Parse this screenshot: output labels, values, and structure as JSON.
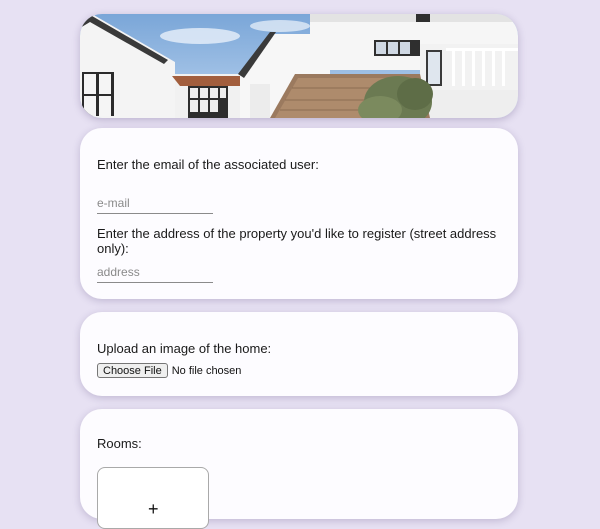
{
  "hero": {
    "alt": "white two-story house with cedar shingle roof and balcony",
    "icon": "house-photo"
  },
  "owner_section": {
    "email_prompt": "Enter the email of the associated user:",
    "email_placeholder": "e-mail",
    "email_value": "",
    "address_prompt": "Enter the address of the property you'd like to register (street address only):",
    "address_placeholder": "address",
    "address_value": ""
  },
  "image_section": {
    "prompt": "Upload an image of the home:",
    "choose_file_label": "Choose File",
    "file_status": "No file chosen"
  },
  "rooms_section": {
    "label": "Rooms:",
    "add_symbol": "+"
  },
  "colors": {
    "page_background": "#e7e1f3",
    "card_background": "#fdfcff",
    "sky": "#8fb4df"
  }
}
